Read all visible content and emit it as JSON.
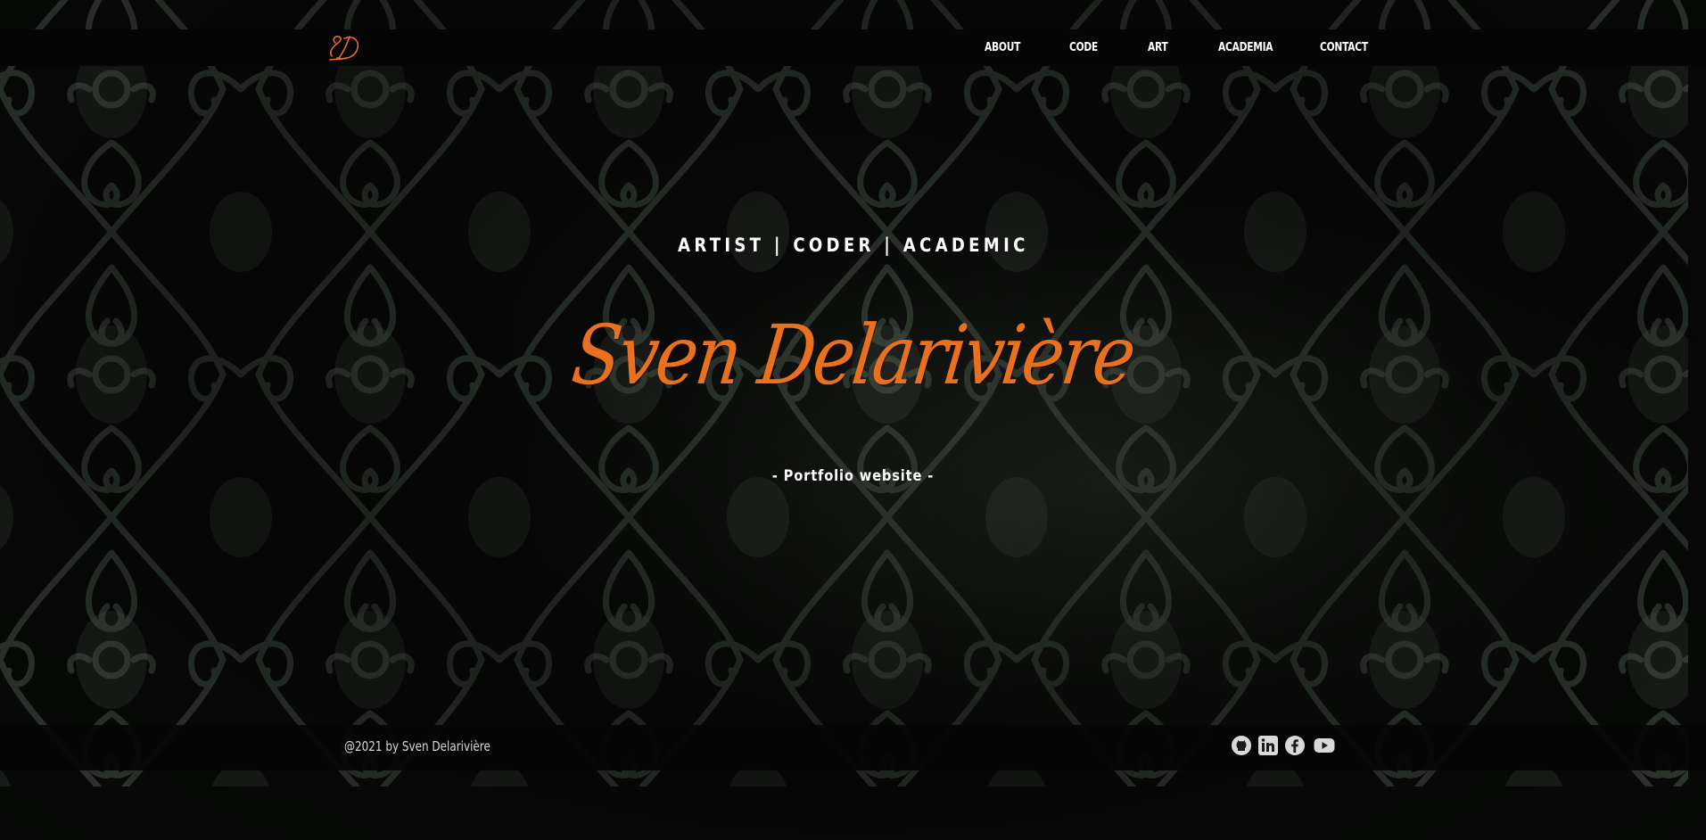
{
  "header": {
    "logo_icon": "sd-monogram-logo-icon",
    "nav": [
      {
        "label": "ABOUT"
      },
      {
        "label": "CODE"
      },
      {
        "label": "ART"
      },
      {
        "label": "ACADEMIA"
      },
      {
        "label": "CONTACT"
      }
    ]
  },
  "hero": {
    "tagline": "ARTIST | CODER | ACADEMIC",
    "name": "Sven Delarivière",
    "subtitle": "- Portfolio website -"
  },
  "footer": {
    "copyright": "@2021 by Sven Delarivière",
    "socials": [
      {
        "icon": "github-icon"
      },
      {
        "icon": "linkedin-icon"
      },
      {
        "icon": "facebook-icon"
      },
      {
        "icon": "youtube-icon"
      }
    ]
  },
  "colors": {
    "accent": "#e8701f",
    "header_bg": "#050505",
    "text": "#ffffff"
  }
}
